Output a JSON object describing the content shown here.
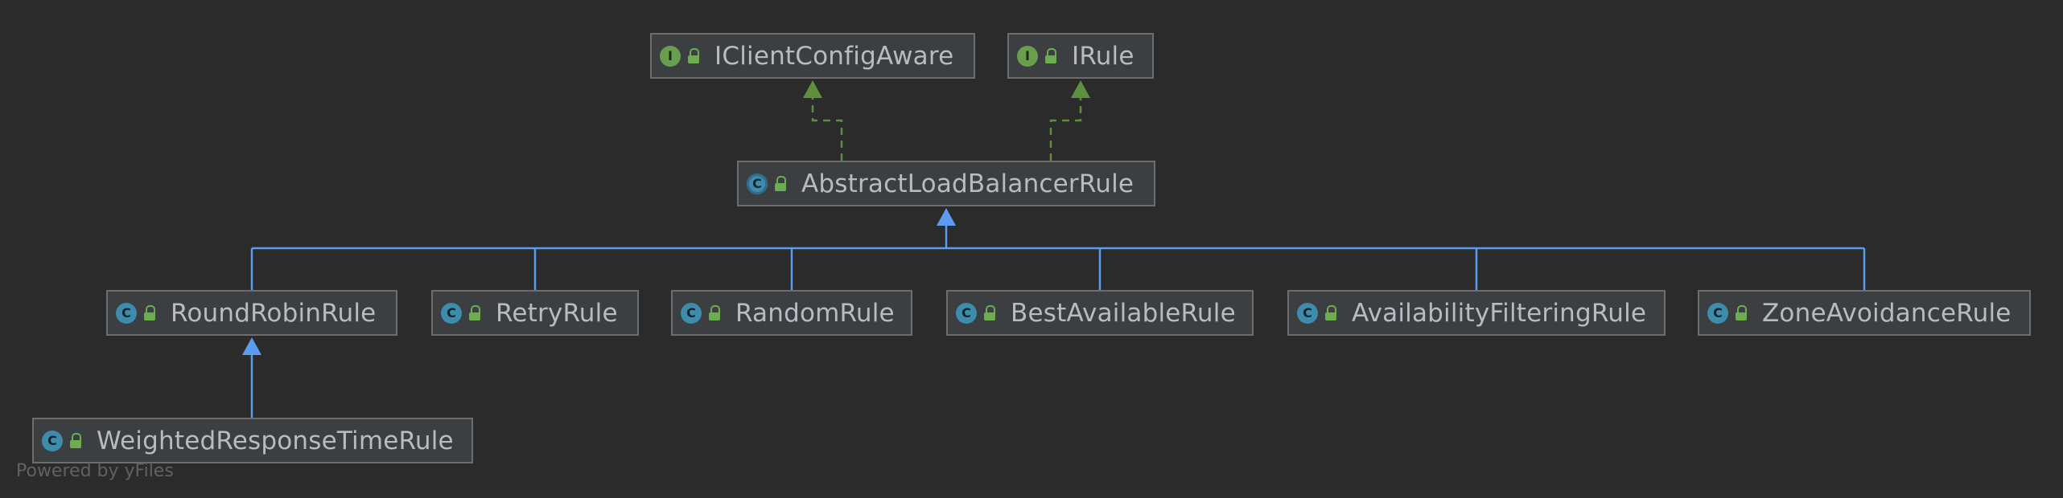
{
  "diagram": {
    "type": "uml-class-hierarchy",
    "colors": {
      "background": "#2b2b2b",
      "node_fill": "#3c3f41",
      "node_border": "#6d6d6d",
      "text": "#b7bcc2",
      "implements_edge": "#5e8f3e",
      "extends_edge": "#5b9bf0"
    },
    "nodes": [
      {
        "id": "iclientconfigaware",
        "label": "IClientConfigAware",
        "kind": "interface",
        "kind_letter": "I",
        "icon": "interface-icon"
      },
      {
        "id": "irule",
        "label": "IRule",
        "kind": "interface",
        "kind_letter": "I",
        "icon": "interface-icon"
      },
      {
        "id": "abstractloadbalancerrule",
        "label": "AbstractLoadBalancerRule",
        "kind": "abstract",
        "kind_letter": "C",
        "icon": "abstract-class-icon"
      },
      {
        "id": "roundrobinrule",
        "label": "RoundRobinRule",
        "kind": "class",
        "kind_letter": "C",
        "icon": "class-icon"
      },
      {
        "id": "retryrule",
        "label": "RetryRule",
        "kind": "class",
        "kind_letter": "C",
        "icon": "class-icon"
      },
      {
        "id": "randomrule",
        "label": "RandomRule",
        "kind": "class",
        "kind_letter": "C",
        "icon": "class-icon"
      },
      {
        "id": "bestavailablerule",
        "label": "BestAvailableRule",
        "kind": "class",
        "kind_letter": "C",
        "icon": "class-icon"
      },
      {
        "id": "availabilityfilteringrule",
        "label": "AvailabilityFilteringRule",
        "kind": "class",
        "kind_letter": "C",
        "icon": "class-icon"
      },
      {
        "id": "zoneavoidancerule",
        "label": "ZoneAvoidanceRule",
        "kind": "class",
        "kind_letter": "C",
        "icon": "class-icon"
      },
      {
        "id": "weightedresponsetimerule",
        "label": "WeightedResponseTimeRule",
        "kind": "class",
        "kind_letter": "C",
        "icon": "class-icon"
      }
    ],
    "edges": [
      {
        "from": "abstractloadbalancerrule",
        "to": "iclientconfigaware",
        "type": "implements"
      },
      {
        "from": "abstractloadbalancerrule",
        "to": "irule",
        "type": "implements"
      },
      {
        "from": "roundrobinrule",
        "to": "abstractloadbalancerrule",
        "type": "extends"
      },
      {
        "from": "retryrule",
        "to": "abstractloadbalancerrule",
        "type": "extends"
      },
      {
        "from": "randomrule",
        "to": "abstractloadbalancerrule",
        "type": "extends"
      },
      {
        "from": "bestavailablerule",
        "to": "abstractloadbalancerrule",
        "type": "extends"
      },
      {
        "from": "availabilityfilteringrule",
        "to": "abstractloadbalancerrule",
        "type": "extends"
      },
      {
        "from": "zoneavoidancerule",
        "to": "abstractloadbalancerrule",
        "type": "extends"
      },
      {
        "from": "weightedresponsetimerule",
        "to": "roundrobinrule",
        "type": "extends"
      }
    ]
  },
  "footer": {
    "watermark": "Powered by yFiles"
  }
}
